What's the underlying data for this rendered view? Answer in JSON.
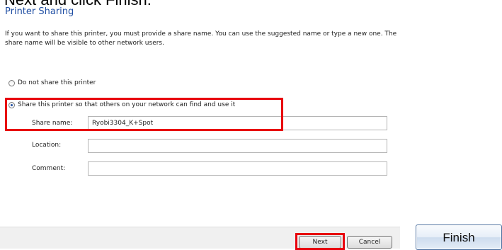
{
  "caption": "Next and click Finish.",
  "dialog": {
    "title": "Printer Sharing",
    "description": "If you want to share this printer, you must provide a share name. You can use the suggested name or type a new one. The share name will be visible to other network users."
  },
  "options": {
    "no_share_label": "Do not share this printer",
    "share_label": "Share this printer so that others on your network can find and use it",
    "selected": "share"
  },
  "fields": {
    "share_name_label": "Share name:",
    "share_name_value": "Ryobi3304_K+Spot",
    "location_label": "Location:",
    "location_value": "",
    "comment_label": "Comment:",
    "comment_value": ""
  },
  "buttons": {
    "next": "Next",
    "cancel": "Cancel",
    "finish": "Finish"
  },
  "colors": {
    "highlight": "#e8000d",
    "title": "#1f4ea3"
  }
}
